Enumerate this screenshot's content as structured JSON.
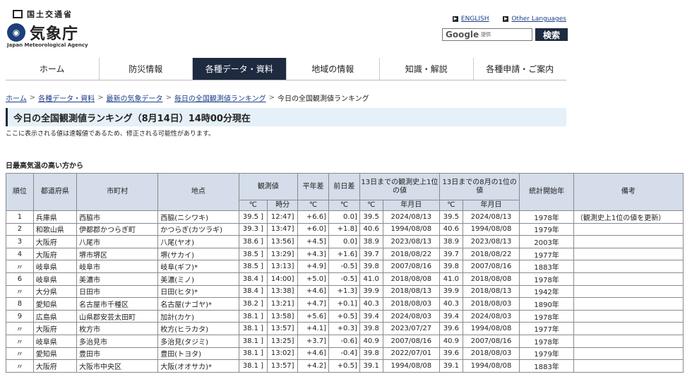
{
  "header": {
    "ministry": "国土交通省",
    "agency_name": "気象庁",
    "agency_en": "Japan Meteorological Agency",
    "links": [
      "ENGLISH",
      "Other Languages"
    ],
    "search": {
      "brand": "Google",
      "sub": "提供",
      "button": "検索"
    }
  },
  "nav": {
    "items": [
      "ホーム",
      "防災情報",
      "各種データ・資料",
      "地域の情報",
      "知識・解説",
      "各種申請・ご案内"
    ]
  },
  "breadcrumb": [
    "ホーム",
    "各種データ・資料",
    "最新の気象データ",
    "毎日の全国観測値ランキング",
    "今日の全国観測値ランキング"
  ],
  "page": {
    "title": "今日の全国観測値ランキング（8月14日）14時00分現在",
    "notice": "ここに表示される値は速報値であるため、修正される可能性があります。",
    "section": "日最高気温の高い方から"
  },
  "table": {
    "headers": {
      "rank": "順位",
      "pref": "都道府県",
      "city": "市町村",
      "point": "地点",
      "obs": "観測値",
      "normal": "平年差",
      "prev": "前日差",
      "record_hist": "13日までの観測史上1位の値",
      "record_aug": "13日までの8月の1位の値",
      "start": "統計開始年",
      "note": "備考",
      "unit_c": "℃",
      "unit_time": "時分",
      "unit_date": "年月日"
    },
    "rows": [
      {
        "rank": "1",
        "pref": "兵庫県",
        "city": "西脇市",
        "point": "西脇(ニシワキ)",
        "val": "39.5 ]",
        "time": "12:47]",
        "normal": "+6.6]",
        "prev": "0.0]",
        "h_val": "39.5",
        "h_date": "2024/08/13",
        "a_val": "39.5",
        "a_date": "2024/08/13",
        "start": "1978年",
        "note": "（観測史上1位の値を更新）"
      },
      {
        "rank": "2",
        "pref": "和歌山県",
        "city": "伊都郡かつらぎ町",
        "point": "かつらぎ(カツラギ)",
        "val": "39.3 ]",
        "time": "13:47]",
        "normal": "+6.0]",
        "prev": "+1.8]",
        "h_val": "40.6",
        "h_date": "1994/08/08",
        "a_val": "40.6",
        "a_date": "1994/08/08",
        "start": "1979年",
        "note": ""
      },
      {
        "rank": "3",
        "pref": "大阪府",
        "city": "八尾市",
        "point": "八尾(ヤオ)",
        "val": "38.6 ]",
        "time": "13:56]",
        "normal": "+4.5]",
        "prev": "0.0]",
        "h_val": "38.9",
        "h_date": "2023/08/13",
        "a_val": "38.9",
        "a_date": "2023/08/13",
        "start": "2003年",
        "note": ""
      },
      {
        "rank": "4",
        "pref": "大阪府",
        "city": "堺市堺区",
        "point": "堺(サカイ)",
        "val": "38.5 ]",
        "time": "13:29]",
        "normal": "+4.3]",
        "prev": "+1.6]",
        "h_val": "39.7",
        "h_date": "2018/08/22",
        "a_val": "39.7",
        "a_date": "2018/08/22",
        "start": "1977年",
        "note": ""
      },
      {
        "rank": "〃",
        "pref": "岐阜県",
        "city": "岐阜市",
        "point": "岐阜(ギフ)*",
        "val": "38.5 ]",
        "time": "13:13]",
        "normal": "+4.9]",
        "prev": "-0.5]",
        "h_val": "39.8",
        "h_date": "2007/08/16",
        "a_val": "39.8",
        "a_date": "2007/08/16",
        "start": "1883年",
        "note": ""
      },
      {
        "rank": "6",
        "pref": "岐阜県",
        "city": "美濃市",
        "point": "美濃(ミノ)",
        "val": "38.4 ]",
        "time": "14:00]",
        "normal": "+5.0]",
        "prev": "-0.5]",
        "h_val": "41.0",
        "h_date": "2018/08/08",
        "a_val": "41.0",
        "a_date": "2018/08/08",
        "start": "1978年",
        "note": ""
      },
      {
        "rank": "〃",
        "pref": "大分県",
        "city": "日田市",
        "point": "日田(ヒタ)*",
        "val": "38.4 ]",
        "time": "13:38]",
        "normal": "+4.6]",
        "prev": "+1.3]",
        "h_val": "39.9",
        "h_date": "2018/08/13",
        "a_val": "39.9",
        "a_date": "2018/08/13",
        "start": "1942年",
        "note": ""
      },
      {
        "rank": "8",
        "pref": "愛知県",
        "city": "名古屋市千種区",
        "point": "名古屋(ナゴヤ)*",
        "val": "38.2 ]",
        "time": "13:21]",
        "normal": "+4.7]",
        "prev": "+0.1]",
        "h_val": "40.3",
        "h_date": "2018/08/03",
        "a_val": "40.3",
        "a_date": "2018/08/03",
        "start": "1890年",
        "note": ""
      },
      {
        "rank": "9",
        "pref": "広島県",
        "city": "山県郡安芸太田町",
        "point": "加計(カケ)",
        "val": "38.1 ]",
        "time": "13:58]",
        "normal": "+5.6]",
        "prev": "+0.5]",
        "h_val": "39.4",
        "h_date": "2024/08/03",
        "a_val": "39.4",
        "a_date": "2024/08/03",
        "start": "1978年",
        "note": ""
      },
      {
        "rank": "〃",
        "pref": "大阪府",
        "city": "枚方市",
        "point": "枚方(ヒラカタ)",
        "val": "38.1 ]",
        "time": "13:57]",
        "normal": "+4.1]",
        "prev": "+0.3]",
        "h_val": "39.8",
        "h_date": "2023/07/27",
        "a_val": "39.6",
        "a_date": "1994/08/08",
        "start": "1977年",
        "note": ""
      },
      {
        "rank": "〃",
        "pref": "岐阜県",
        "city": "多治見市",
        "point": "多治見(タジミ)",
        "val": "38.1 ]",
        "time": "13:25]",
        "normal": "+3.7]",
        "prev": "-0.6]",
        "h_val": "40.9",
        "h_date": "2007/08/16",
        "a_val": "40.9",
        "a_date": "2007/08/16",
        "start": "1978年",
        "note": ""
      },
      {
        "rank": "〃",
        "pref": "愛知県",
        "city": "豊田市",
        "point": "豊田(トヨタ)",
        "val": "38.1 ]",
        "time": "13:02]",
        "normal": "+4.6]",
        "prev": "-0.4]",
        "h_val": "39.8",
        "h_date": "2022/07/01",
        "a_val": "39.6",
        "a_date": "2018/08/03",
        "start": "1979年",
        "note": ""
      },
      {
        "rank": "〃",
        "pref": "大阪府",
        "city": "大阪市中央区",
        "point": "大阪(オオサカ)*",
        "val": "38.1 ]",
        "time": "13:57]",
        "normal": "+4.2]",
        "prev": "+0.5]",
        "h_val": "39.1",
        "h_date": "1994/08/08",
        "a_val": "39.1",
        "a_date": "1994/08/08",
        "start": "1883年",
        "note": ""
      }
    ]
  }
}
